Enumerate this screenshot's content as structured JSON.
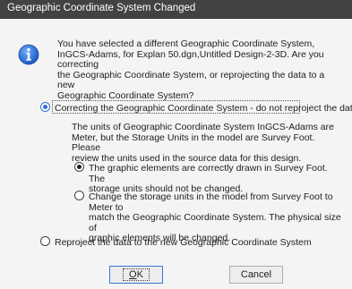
{
  "window": {
    "title": "Geographic Coordinate System Changed"
  },
  "icons": {
    "info": "information-icon"
  },
  "message": {
    "lines": [
      "You have selected a different Geographic Coordinate System,",
      "InGCS-Adams, for Explan 50.dgn,Untitled Design-2-3D. Are you correcting",
      "the Geographic Coordinate System, or reprojecting the data to a new",
      "Geographic Coordinate System?"
    ]
  },
  "options": {
    "correct": {
      "label": "Correcting the Geographic Coordinate System - do not reproject the data",
      "selected": true
    },
    "reproject": {
      "label": "Reproject the data to the new Geographic Coordinate System",
      "selected": false
    }
  },
  "units_note": {
    "lines": [
      "The units of Geographic Coordinate System InGCS-Adams are",
      "Meter, but the Storage Units in the model are Survey Foot. Please",
      "review the units used in the source data for this design."
    ]
  },
  "sub_options": {
    "keep": {
      "lines": [
        "The graphic elements are correctly drawn in Survey Foot. The",
        "storage units should not be changed."
      ],
      "selected": true
    },
    "change": {
      "lines": [
        "Change the storage units in the model from Survey Foot to Meter to",
        "match the Geographic Coordinate System. The physical size of",
        "graphic elements will be changed."
      ],
      "selected": false
    }
  },
  "buttons": {
    "ok": {
      "label": "OK",
      "mnemonic": "O",
      "rest": "K"
    },
    "cancel": {
      "label": "Cancel"
    }
  }
}
